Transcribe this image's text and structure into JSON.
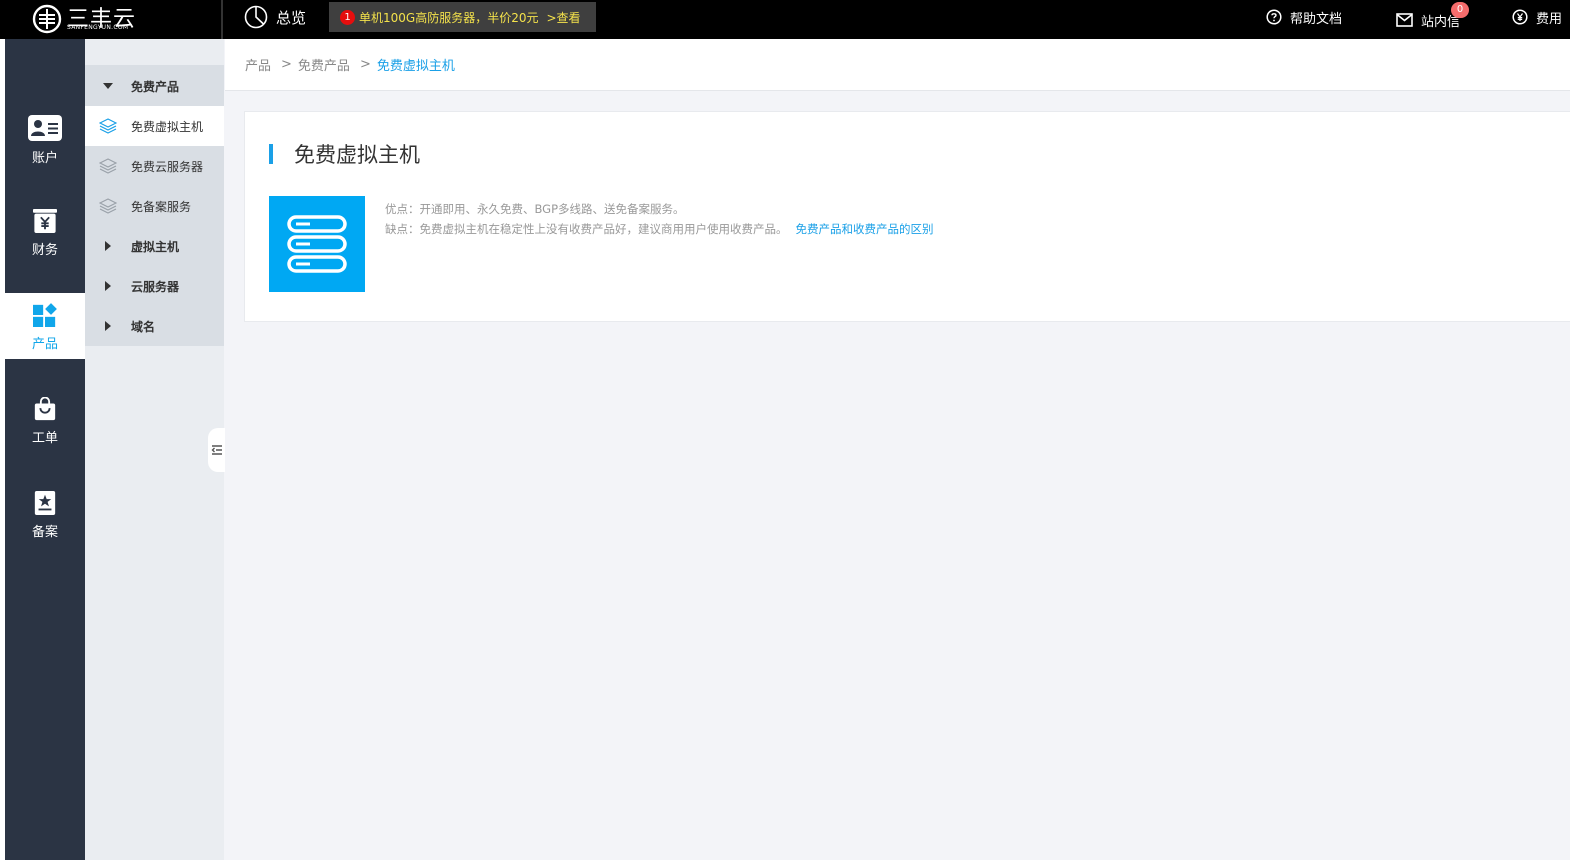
{
  "topbar": {
    "logo_text": "三丰云",
    "logo_sub": "SANFENGYUN.COM",
    "overview_label": "总览",
    "promo": {
      "badge": "1",
      "text": "单机100G高防服务器，半价20元",
      "link": ">查看"
    },
    "help_label": "帮助文档",
    "messages_label": "站内信",
    "messages_count": "0",
    "fee_label": "费用"
  },
  "leftnav": {
    "items": [
      {
        "label": "账户",
        "icon": "account-card-icon"
      },
      {
        "label": "财务",
        "icon": "finance-yuan-icon"
      },
      {
        "label": "产品",
        "icon": "product-grid-icon",
        "active": true
      },
      {
        "label": "工单",
        "icon": "ticket-bag-icon"
      },
      {
        "label": "备案",
        "icon": "filing-star-icon"
      }
    ]
  },
  "submenu": {
    "group_free": "免费产品",
    "free_vhost": "免费虚拟主机",
    "free_cloud": "免费云服务器",
    "free_nofiling": "免备案服务",
    "group_vhost": "虚拟主机",
    "group_cloud": "云服务器",
    "group_domain": "域名"
  },
  "breadcrumb": {
    "root": "产品",
    "sep": ">",
    "parent": "免费产品",
    "current": "免费虚拟主机"
  },
  "content": {
    "title": "免费虚拟主机",
    "pros": "优点：开通即用、永久免费、BGP多线路、送免备案服务。",
    "cons": "缺点：免费虚拟主机在稳定性上没有收费产品好，建议商用用户使用收费产品。",
    "diff_link": "免费产品和收费产品的区别"
  },
  "colors": {
    "accent": "#1aa0e7",
    "tile": "#00a8f3",
    "nav_bg": "#2b3444",
    "promo_text": "#f4e24b"
  }
}
